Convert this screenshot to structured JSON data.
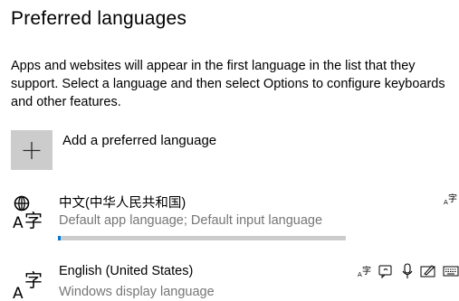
{
  "page": {
    "title": "Preferred languages",
    "description": "Apps and websites will appear in the first language in the list that they support. Select a language and then select Options to configure keyboards and other features."
  },
  "add_language": {
    "icon": "plus-icon",
    "label": "Add a preferred language"
  },
  "languages": [
    {
      "name": "中文(中华人民共和国)",
      "subtitle": "Default app language; Default input language",
      "icon": "language-globe-icon",
      "download_progress": 0.01,
      "features": [
        "display-language-icon"
      ]
    },
    {
      "name": "English (United States)",
      "subtitle": "Windows display language",
      "icon": "language-icon",
      "features": [
        "display-language-icon",
        "speech-icon",
        "microphone-icon",
        "handwriting-icon",
        "keyboard-icon"
      ]
    }
  ],
  "colors": {
    "accent": "#0078d7",
    "add_button_bg": "#cccccc",
    "secondary_text": "#767676",
    "progress_track": "#cccccc"
  }
}
